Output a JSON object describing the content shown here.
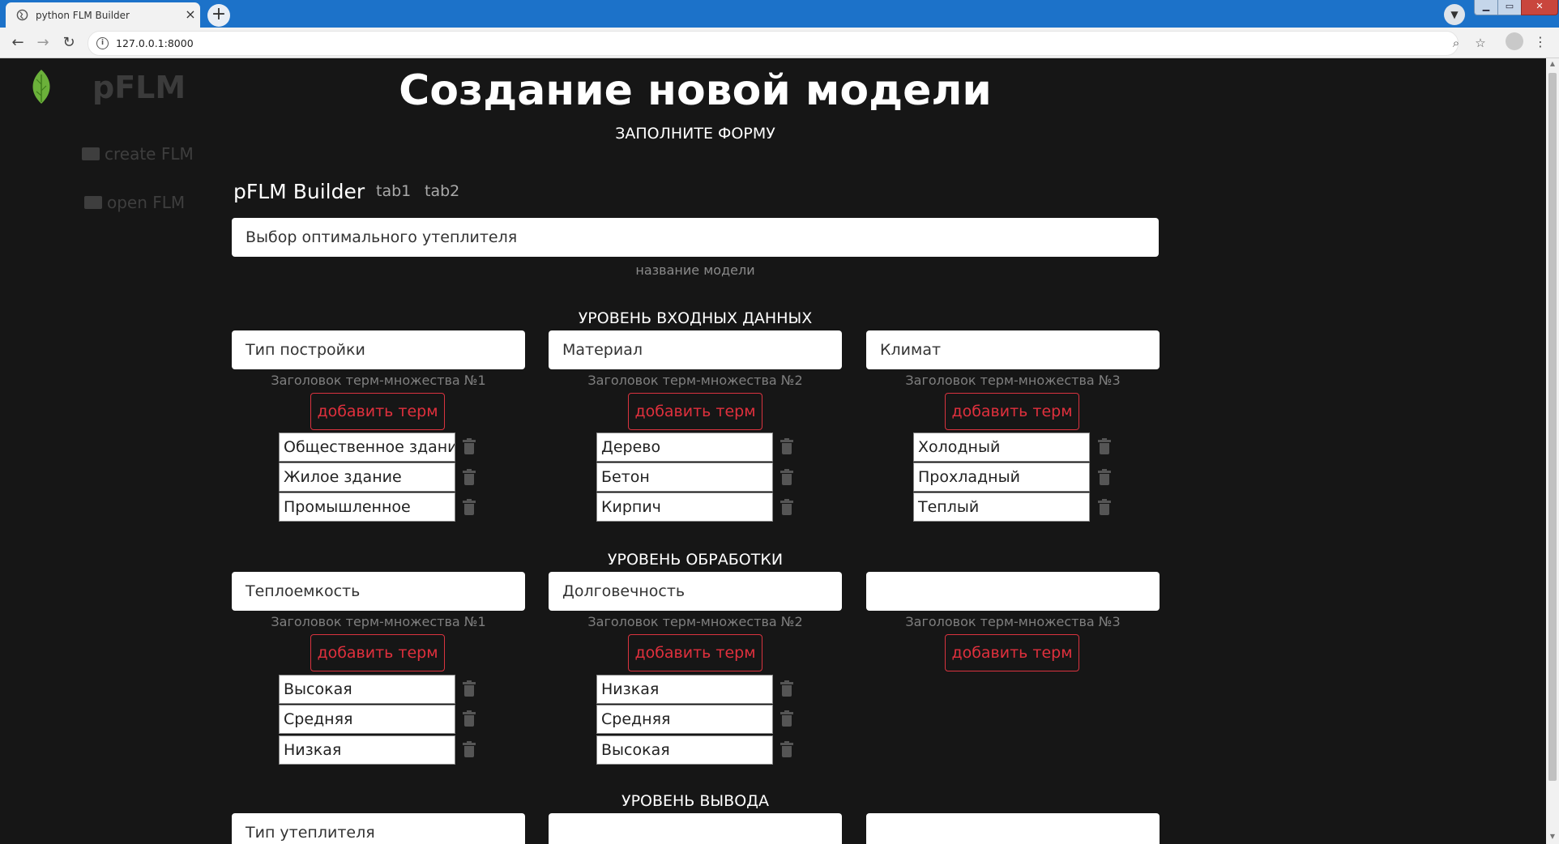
{
  "browser": {
    "tab_title": "python FLM Builder",
    "tab_close": "×",
    "new_tab": "+",
    "url": "127.0.0.1:8000"
  },
  "sidebar": {
    "brand": "pFLM",
    "links": [
      {
        "label": "create FLM"
      },
      {
        "label": "open FLM"
      }
    ]
  },
  "header": {
    "title": "Создание новой модели",
    "subtitle": "ЗАПОЛНИТЕ ФОРМУ"
  },
  "builder": {
    "title": "pFLM Builder",
    "tabs": [
      "tab1",
      "tab2"
    ]
  },
  "model": {
    "name_value": "Выбор оптимального утеплителя",
    "name_hint": "название модели"
  },
  "levels": [
    {
      "title": "УРОВЕНЬ ВХОДНЫХ ДАННЫХ",
      "columns": [
        {
          "value": "Тип постройки",
          "hint": "Заголовок терм-множества №1",
          "add_label": "добавить терм",
          "terms": [
            "Общественное здание",
            "Жилое здание",
            "Промышленное"
          ]
        },
        {
          "value": "Материал",
          "hint": "Заголовок терм-множества №2",
          "add_label": "добавить терм",
          "terms": [
            "Дерево",
            "Бетон",
            "Кирпич"
          ]
        },
        {
          "value": "Климат",
          "hint": "Заголовок терм-множества №3",
          "add_label": "добавить терм",
          "terms": [
            "Холодный",
            "Прохладный",
            "Теплый"
          ]
        }
      ]
    },
    {
      "title": "УРОВЕНЬ ОБРАБОТКИ",
      "columns": [
        {
          "value": "Теплоемкость",
          "hint": "Заголовок терм-множества №1",
          "add_label": "добавить терм",
          "terms": [
            "Высокая",
            "Средняя",
            "Низкая"
          ]
        },
        {
          "value": "Долговечность",
          "hint": "Заголовок терм-множества №2",
          "add_label": "добавить терм",
          "terms": [
            "Низкая",
            "Средняя",
            "Высокая"
          ]
        },
        {
          "value": "",
          "hint": "Заголовок терм-множества №3",
          "add_label": "добавить терм",
          "terms": []
        }
      ]
    },
    {
      "title": "УРОВЕНЬ ВЫВОДА",
      "columns": [
        {
          "value": "Тип утеплителя"
        },
        {
          "value": ""
        },
        {
          "value": ""
        }
      ]
    }
  ],
  "colors": {
    "background": "#161616",
    "accent_red": "#e0303d",
    "chrome_blue": "#1c72c9",
    "leaf_green": "#6bb13a"
  }
}
